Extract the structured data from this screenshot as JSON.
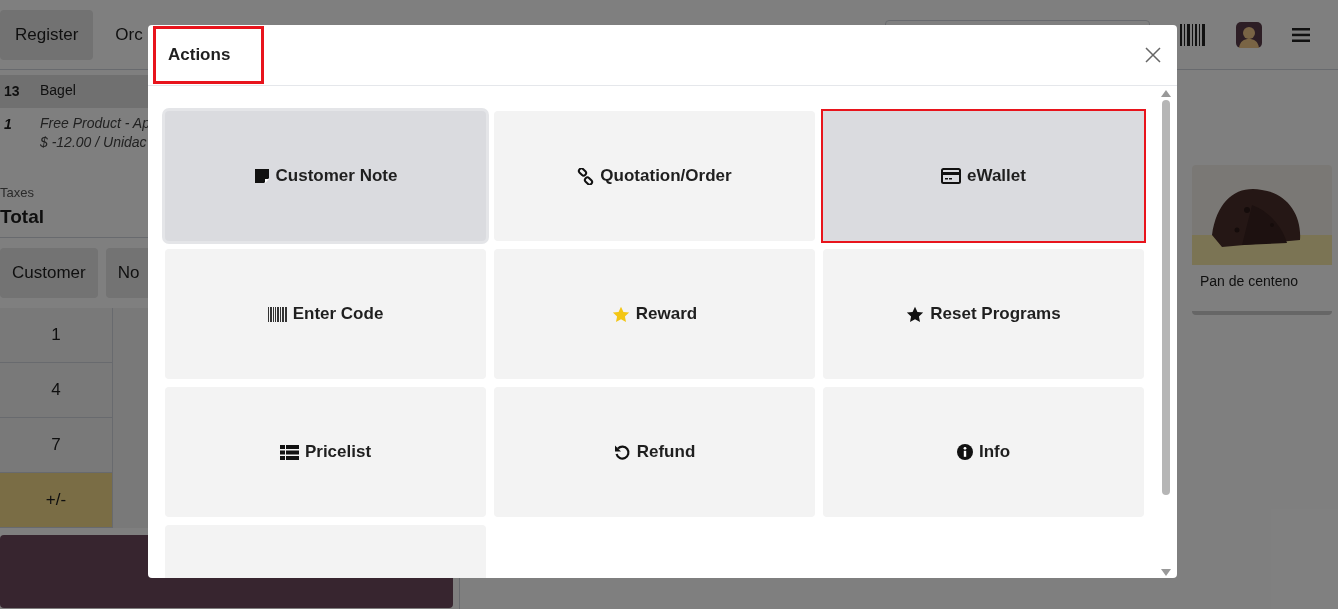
{
  "top_bar": {
    "register_button": "Register",
    "orders_tab": "Orc"
  },
  "order_lines": [
    {
      "kind": "product",
      "quantity": "13",
      "product": "Bagel",
      "selected": true
    },
    {
      "kind": "reward",
      "quantity": "1",
      "product": "Free Product - Ap",
      "price": "$ -12.00 / Unidac",
      "selected": false
    }
  ],
  "totals": {
    "taxes_label": "Taxes",
    "total_label": "Total"
  },
  "control_buttons": [
    "Customer",
    "No"
  ],
  "numpad": [
    {
      "kind": "digit",
      "label": "1"
    },
    {
      "kind": "digit",
      "label": "4"
    },
    {
      "kind": "digit",
      "label": "7"
    },
    {
      "kind": "sign",
      "label": "+/-"
    }
  ],
  "products": [
    {
      "name": "Pan de centeno",
      "kind": "picture"
    }
  ],
  "dialog": {
    "title": "Actions",
    "title_annotated": true,
    "actions": [
      {
        "kind": "note",
        "label": "Customer Note",
        "selected": true,
        "annotated": false
      },
      {
        "kind": "link",
        "label": "Quotation/Order",
        "selected": false,
        "annotated": false
      },
      {
        "kind": "card",
        "label": "eWallet",
        "selected": false,
        "annotated": true
      },
      {
        "kind": "barcode",
        "label": "Enter Code",
        "selected": false,
        "annotated": false
      },
      {
        "kind": "star-yellow",
        "label": "Reward",
        "selected": false,
        "annotated": false
      },
      {
        "kind": "star",
        "label": "Reset Programs",
        "selected": false,
        "annotated": false
      },
      {
        "kind": "list",
        "label": "Pricelist",
        "selected": false,
        "annotated": false
      },
      {
        "kind": "refund",
        "label": "Refund",
        "selected": false,
        "annotated": false
      },
      {
        "kind": "info",
        "label": "Info",
        "selected": false,
        "annotated": false
      },
      {
        "kind": "blank",
        "selected": false,
        "annotated": false
      }
    ]
  }
}
